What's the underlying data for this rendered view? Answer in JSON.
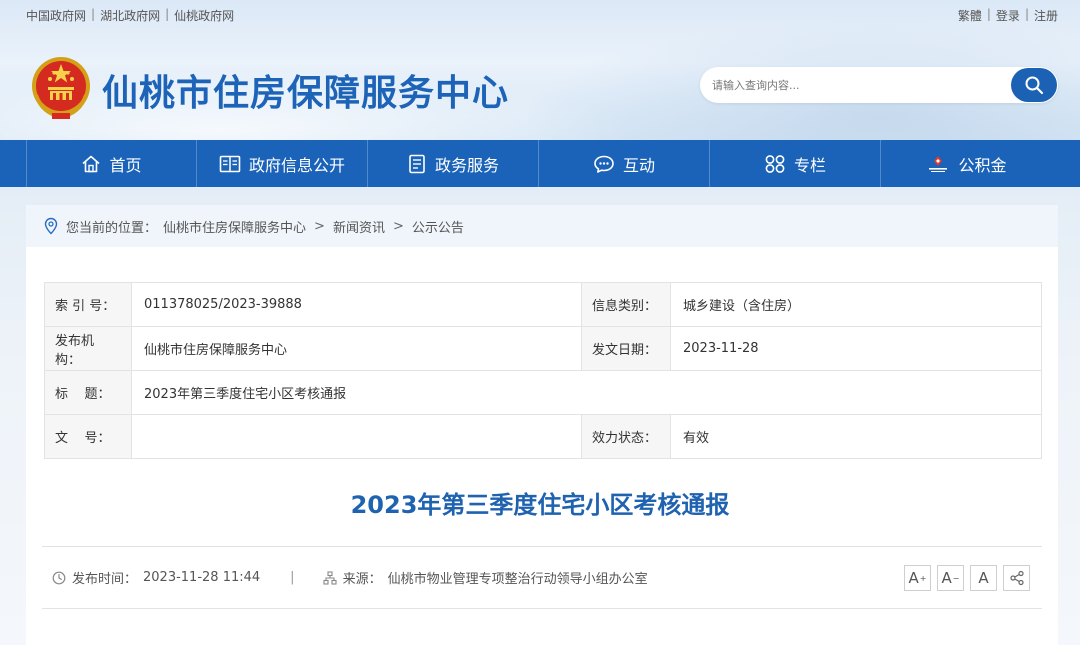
{
  "top_links": [
    "中国政府网",
    "湖北政府网",
    "仙桃政府网"
  ],
  "user_links": [
    "繁體",
    "登录",
    "注册"
  ],
  "site_title": "仙桃市住房保障服务中心",
  "search": {
    "placeholder": "请输入查询内容..."
  },
  "nav": [
    {
      "label": "首页",
      "icon": "home-icon"
    },
    {
      "label": "政府信息公开",
      "icon": "book-icon"
    },
    {
      "label": "政务服务",
      "icon": "document-icon"
    },
    {
      "label": "互动",
      "icon": "chat-icon"
    },
    {
      "label": "专栏",
      "icon": "grid-icon"
    },
    {
      "label": "公积金",
      "icon": "fund-logo-icon"
    }
  ],
  "breadcrumb": {
    "prefix": "您当前的位置：",
    "items": [
      "仙桃市住房保障服务中心",
      "新闻资讯",
      "公示公告"
    ]
  },
  "meta": {
    "index_label": "索 引 号：",
    "index_value": "011378025/2023-39888",
    "category_label": "信息类别：",
    "category_value": "城乡建设（含住房）",
    "publisher_label": "发布机构：",
    "publisher_value": "仙桃市住房保障服务中心",
    "date_label": "发文日期：",
    "date_value": "2023-11-28",
    "title_label": "标    题：",
    "title_value": "2023年第三季度住宅小区考核通报",
    "docno_label": "文    号：",
    "docno_value": "",
    "status_label": "效力状态：",
    "status_value": "有效"
  },
  "article": {
    "title": "2023年第三季度住宅小区考核通报",
    "publish_time_label": "发布时间：",
    "publish_time": "2023-11-28 11:44",
    "source_label": "来源：",
    "source": "仙桃市物业管理专项整治行动领导小组办公室"
  },
  "tools": {
    "font_larger": "A",
    "font_smaller": "A",
    "font_default": "A"
  },
  "colors": {
    "brand": "#1a63b9",
    "title": "#1e62b0"
  }
}
